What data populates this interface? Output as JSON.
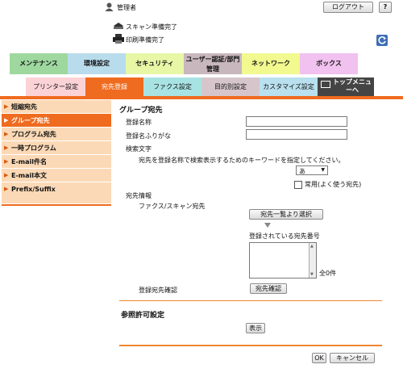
{
  "header": {
    "user_label": "管理者",
    "logout_label": "ログアウト",
    "help_label": "?",
    "status_scan": "スキャン準備完了",
    "status_print": "印刷準備完了"
  },
  "main_tabs": [
    {
      "label": "メンテナンス",
      "color": "#9ed89f"
    },
    {
      "label": "環境設定",
      "color": "#b9dcec"
    },
    {
      "label": "セキュリティ",
      "color": "#e7f7a6"
    },
    {
      "label": "ユーザー認証/部門管理",
      "color": "#c8b7bd"
    },
    {
      "label": "ネットワーク",
      "color": "#f1f98f"
    },
    {
      "label": "ボックス",
      "color": "#f1c1ef"
    }
  ],
  "sub_tabs": [
    {
      "label": "プリンター設定"
    },
    {
      "label": "宛先登録"
    },
    {
      "label": "ファクス設定"
    },
    {
      "label": "目的別設定"
    },
    {
      "label": "カスタマイズ設定"
    },
    {
      "label": "トップメニューへ"
    }
  ],
  "sidebar": {
    "items": [
      {
        "label": "短縮宛先"
      },
      {
        "label": "グループ宛先"
      },
      {
        "label": "プログラム宛先"
      },
      {
        "label": "一時プログラム"
      },
      {
        "label": "E-mail件名"
      },
      {
        "label": "E-mail本文"
      },
      {
        "label": "Prefix/Suffix"
      }
    ]
  },
  "form": {
    "title": "グループ宛先",
    "name_label": "登録名称",
    "name_value": "",
    "furigana_label": "登録名ふりがな",
    "furigana_value": "",
    "search_label": "検索文字",
    "search_hint": "宛先を登録名称で検索表示するためのキーワードを指定してください。",
    "search_select_value": "あ",
    "frequent_label": "常用(よく使う宛先)",
    "dest_info_label": "宛先情報",
    "fax_scan_label": "ファクス/スキャン宛先",
    "select_from_list_label": "宛先一覧より選択",
    "registered_numbers_label": "登録されている宛先番号",
    "count_label": "全0件",
    "confirm_label": "登録宛先確認",
    "confirm_button": "宛先確認",
    "ref_title": "参照許可設定",
    "display_button": "表示",
    "ok_button": "OK",
    "cancel_button": "キャンセル"
  },
  "colors": {
    "accent": "#ef6b1f",
    "sidebar_bg": "#fcd9b6",
    "divider": "#f0872f"
  }
}
